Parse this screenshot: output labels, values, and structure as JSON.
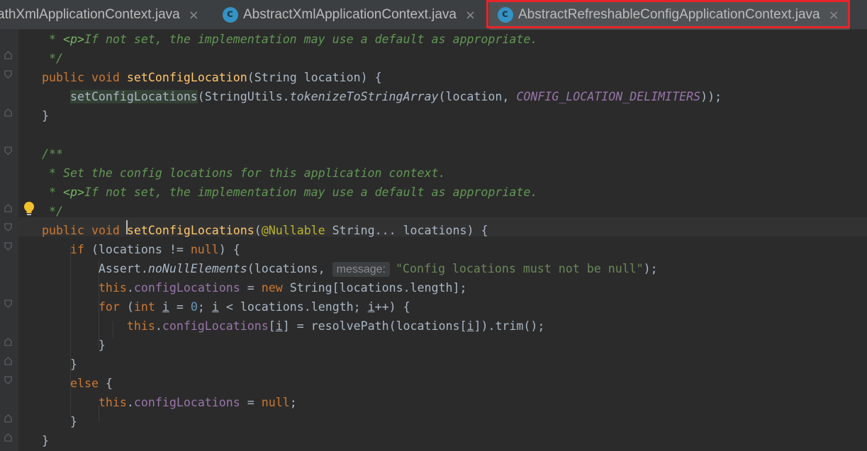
{
  "tabs": [
    {
      "title": "athXmlApplicationContext.java",
      "icon": "java-class-icon",
      "active": false,
      "closable": true
    },
    {
      "title": "AbstractXmlApplicationContext.java",
      "icon": "java-class-icon",
      "active": false,
      "closable": true
    },
    {
      "title": "AbstractRefreshableConfigApplicationContext.java",
      "icon": "java-class-icon",
      "active": true,
      "closable": true
    }
  ],
  "tab_close_glyph": "×",
  "highlight_color": "#e8242a",
  "code_lines": {
    "l1": " * <p>If not set, the implementation may use a default as appropriate.",
    "l2": " */",
    "l3": "public void setConfigLocation(String location) {",
    "l4": "    setConfigLocations(StringUtils.tokenizeToStringArray(location, CONFIG_LOCATION_DELIMITERS));",
    "l5": "}",
    "l6": "",
    "l7": "/**",
    "l8": " * Set the config locations for this application context.",
    "l9": " * <p>If not set, the implementation may use a default as appropriate.",
    "l10": " */",
    "l11": "public void setConfigLocations(@Nullable String... locations) {",
    "l12": "    if (locations != null) {",
    "l13": "        Assert.noNullElements(locations, message: \"Config locations must not be null\");",
    "l14": "        this.configLocations = new String[locations.length];",
    "l15": "        for (int i = 0; i < locations.length; i++) {",
    "l16": "            this.configLocations[i] = resolvePath(locations[i]).trim();",
    "l17": "        }",
    "l18": "    }",
    "l19": "    else {",
    "l20": "        this.configLocations = null;",
    "l21": "    }",
    "l22": "}"
  },
  "param_hint": "message:",
  "gutter_icons": {
    "intention": "lightbulb-icon",
    "fold": "fold-marker-icon"
  }
}
